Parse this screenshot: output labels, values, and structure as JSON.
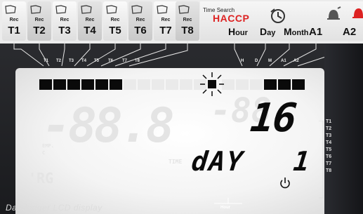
{
  "top_buttons": [
    {
      "rec": "Rec",
      "label": "T1"
    },
    {
      "rec": "Rec",
      "label": "T2"
    },
    {
      "rec": "Rec",
      "label": "T3"
    },
    {
      "rec": "Rec",
      "label": "T4"
    },
    {
      "rec": "Rec",
      "label": "T5"
    },
    {
      "rec": "Rec",
      "label": "T6"
    },
    {
      "rec": "Rec",
      "label": "T7"
    },
    {
      "rec": "Rec",
      "label": "T8"
    }
  ],
  "time_search": {
    "title": "Time Search",
    "haccp": "HACCP",
    "hour": "Hour",
    "day": "Day",
    "month": "Month"
  },
  "alarms": {
    "a1": "A1",
    "a2": "A2"
  },
  "indicator_labels": [
    "T1",
    "T2",
    "T3",
    "T4",
    "T5",
    "T6",
    "T7",
    "T8",
    "H",
    "D",
    "M",
    "A1",
    "A2"
  ],
  "lcd": {
    "main_value": "16",
    "sub_label": "dAY",
    "sub_value": "1",
    "ghost_main": "-88.8",
    "ghost_time": "-88",
    "ghost_rg": "'RG",
    "ghost_emp": "EMP.",
    "ghost_c": "C",
    "ghost_time_lbl": "TIME",
    "bar_segments": [
      1,
      1,
      1,
      1,
      1,
      1,
      0,
      0,
      0,
      0,
      0,
      0,
      0,
      0,
      0,
      1,
      1,
      1
    ]
  },
  "side_scale": [
    "T1",
    "T2",
    "T3",
    "T4",
    "T5",
    "T6",
    "T7",
    "T8"
  ],
  "hour_marker": "Hour",
  "caption": "Datalogger LCD display",
  "colors": {
    "accent_red": "#d22222",
    "lcd_black": "#0b0b0b",
    "strip_bg": "#ececec"
  },
  "icons": {
    "rec_button": "folder-icon",
    "haccp": "clock-arrow-icon",
    "alarm1": "bell-icon",
    "alarm2": "bell-red-icon",
    "sun": "sun-icon",
    "power": "power-icon"
  }
}
